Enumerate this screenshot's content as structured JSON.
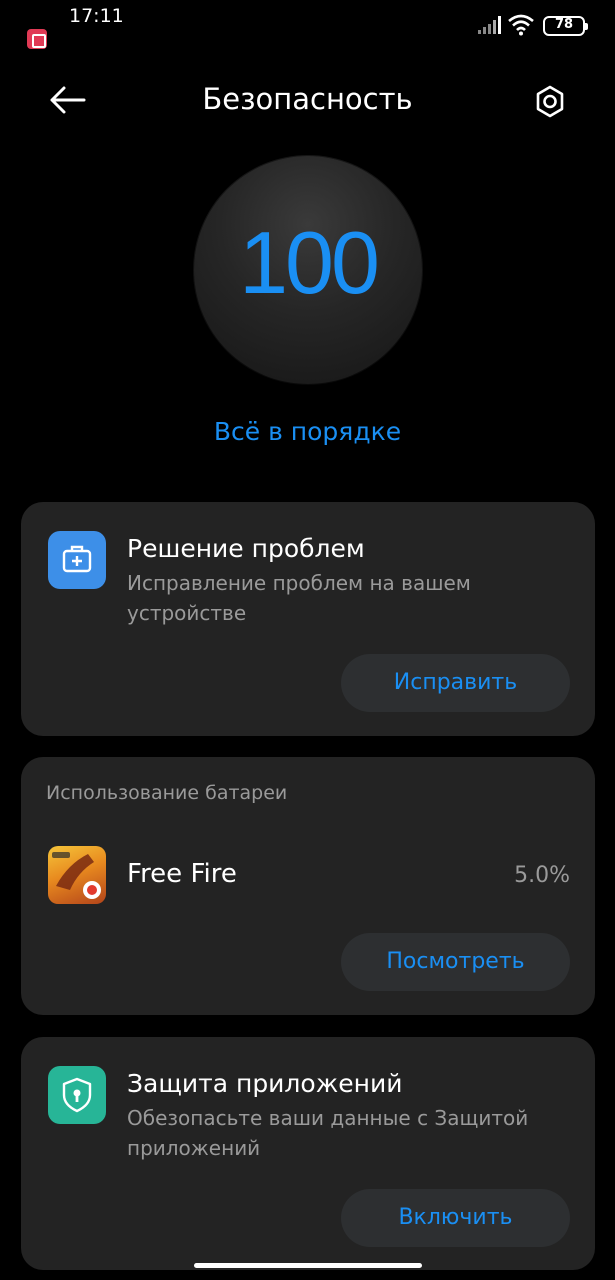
{
  "status_bar": {
    "time": "17:11",
    "battery_level": "78",
    "icons": [
      "notification-app-icon",
      "signal-icon",
      "wifi-icon",
      "battery-icon"
    ]
  },
  "header": {
    "title": "Безопасность",
    "back_icon": "arrow-left-icon",
    "settings_icon": "gear-icon"
  },
  "score": {
    "value": "100",
    "status": "Всё в порядке",
    "accent_color": "#1a8ff3"
  },
  "troubleshoot": {
    "icon": "first-aid-kit-icon",
    "icon_color": "#3d8fe8",
    "title": "Решение проблем",
    "description": "Исправление проблем на вашем устройстве",
    "button_label": "Исправить"
  },
  "battery_usage": {
    "header": "Использование батареи",
    "apps": [
      {
        "name": "Free Fire",
        "usage": "5.0%",
        "icon": "free-fire-app-icon"
      }
    ],
    "button_label": "Посмотреть"
  },
  "app_protection": {
    "icon": "shield-lock-icon",
    "icon_color": "#27b597",
    "title": "Защита приложений",
    "description": "Обезопасьте ваши данные с Защитой приложений",
    "button_label": "Включить"
  }
}
